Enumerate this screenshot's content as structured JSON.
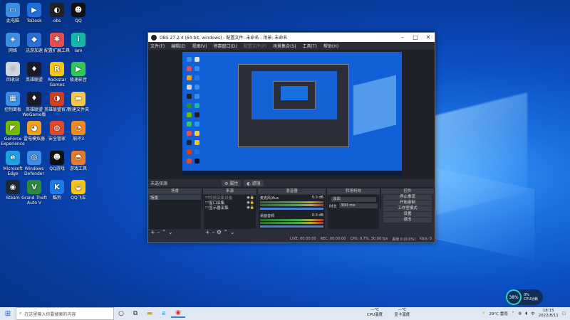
{
  "desktop": {
    "icons": [
      {
        "label": "此电脑",
        "color": "#3a8ee6",
        "glyph": "▭"
      },
      {
        "label": "网络",
        "color": "#3a8ee6",
        "glyph": "◈"
      },
      {
        "label": "回收站",
        "color": "#cfd6df",
        "glyph": "♲"
      },
      {
        "label": "控制面板",
        "color": "#3a8ee6",
        "glyph": "▦"
      },
      {
        "label": "GeForce Experience",
        "color": "#76b900",
        "glyph": "◤"
      },
      {
        "label": "Microsoft Edge",
        "color": "#1fa0e0",
        "glyph": "e"
      },
      {
        "label": "Steam",
        "color": "#1b2838",
        "glyph": "◉"
      },
      {
        "label": "ToDesk",
        "color": "#1f6fe0",
        "glyph": "▶"
      },
      {
        "label": "迅游加速",
        "color": "#2b6ed6",
        "glyph": "◆"
      },
      {
        "label": "英雄联盟",
        "color": "#1a1a2a",
        "glyph": "♦"
      },
      {
        "label": "英雄联盟WeGame版",
        "color": "#1a1a2a",
        "glyph": "♦"
      },
      {
        "label": "雷电模拟器",
        "color": "#f0a020",
        "glyph": "◕"
      },
      {
        "label": "Windows Defender",
        "color": "#3a8ee6",
        "glyph": "◎"
      },
      {
        "label": "Grand Theft Auto V",
        "color": "#2b8a3e",
        "glyph": "V"
      },
      {
        "label": "obs",
        "color": "#222",
        "glyph": "◐"
      },
      {
        "label": "配置扩展工具",
        "color": "#e05050",
        "glyph": "✱"
      },
      {
        "label": "Rockstar Games",
        "color": "#f5c518",
        "glyph": "R"
      },
      {
        "label": "英雄联盟官方",
        "color": "#d04020",
        "glyph": "◑"
      },
      {
        "label": "安全管家",
        "color": "#e04a2a",
        "glyph": "◍"
      },
      {
        "label": "QQ游戏",
        "color": "#111",
        "glyph": "☻"
      },
      {
        "label": "酷狗",
        "color": "#1e7be6",
        "glyph": "K"
      },
      {
        "label": "QQ",
        "color": "#111",
        "glyph": "☻"
      },
      {
        "label": "iam",
        "color": "#14b8a6",
        "glyph": "i"
      },
      {
        "label": "极速影音",
        "color": "#34c759",
        "glyph": "▶"
      },
      {
        "label": "新建文件夹",
        "color": "#f2c94c",
        "glyph": "▬"
      },
      {
        "label": "崩坏3",
        "color": "#f08a24",
        "glyph": "◔"
      },
      {
        "label": "游戏工具",
        "color": "#e87d2a",
        "glyph": "◓"
      },
      {
        "label": "QQ飞车",
        "color": "#f5c518",
        "glyph": "◒"
      }
    ]
  },
  "obs": {
    "title": "OBS 27.2.4 (64-bit, windows) - 配置文件: 未命名 - 场景: 未命名",
    "menu": [
      "文件(F)",
      "编辑(E)",
      "视图(V)",
      "停靠窗口(D)",
      "配置文件(P)",
      "场景集合(S)",
      "工具(T)",
      "帮助(H)"
    ],
    "menu_dim_index": 4,
    "scene_label": "未选择源",
    "scene_buttons": [
      "属性",
      "滤镜"
    ],
    "docks": {
      "scenes": {
        "title": "场景",
        "items": [
          "场景"
        ]
      },
      "sources": {
        "title": "来源",
        "items": [
          "视频采集设备",
          "窗口采集",
          "显示器采集"
        ]
      },
      "mixer": {
        "title": "混音器",
        "tracks": [
          {
            "name": "麦克风/Aux",
            "db": "0.0 dB"
          },
          {
            "name": "桌面音频",
            "db": "0.0 dB"
          }
        ]
      },
      "transitions": {
        "title": "转场特效",
        "type": "淡出",
        "duration_label": "时长",
        "duration": "300 ms"
      },
      "controls": {
        "title": "控件",
        "buttons": [
          "停止推流",
          "开始录制",
          "工作室模式",
          "设置",
          "退出"
        ]
      }
    },
    "status": [
      "LIVE: 00:00:00",
      "REC: 00:00:00",
      "CPU: 0.7%, 30.00 fps",
      "丢帧 0 (0.0%)",
      "kb/s: 0"
    ]
  },
  "cpu_widget": {
    "percent": "38%",
    "line1": "0%",
    "line2": "CPU功耗"
  },
  "taskbar": {
    "search_placeholder": "在这里输入你要搜索的内容",
    "temp1_label": "CPU温度",
    "temp2_label": "显卡温度",
    "weather": "29°C 雷雨",
    "time": "18:15",
    "date": "2022/8/11"
  }
}
